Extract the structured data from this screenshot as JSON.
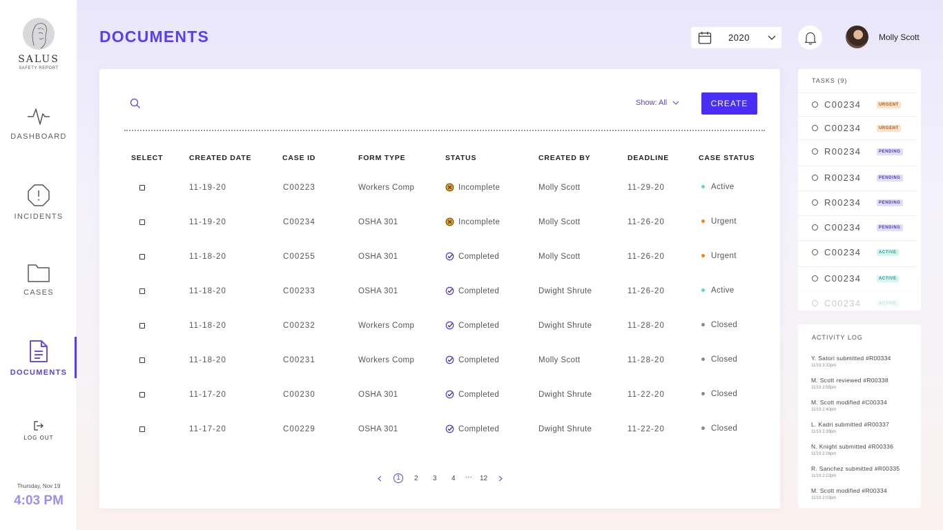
{
  "brand": {
    "name": "SALUS",
    "tagline": "SAFETY REPORT"
  },
  "nav": {
    "dashboard": "DASHBOARD",
    "incidents": "INCIDENTS",
    "cases": "CASES",
    "documents": "DOCUMENTS",
    "logout": "LOG OUT"
  },
  "clock": {
    "date": "Thursday, Nov 19",
    "time": "4:03 PM"
  },
  "header": {
    "title": "DOCUMENTS",
    "year": "2020",
    "user": "Molly Scott"
  },
  "toolbar": {
    "show_filter": "Show: All",
    "create_label": "CREATE"
  },
  "table": {
    "headers": [
      "SELECT",
      "CREATED DATE",
      "CASE ID",
      "FORM TYPE",
      "STATUS",
      "CREATED BY",
      "DEADLINE",
      "CASE STATUS"
    ],
    "rows": [
      {
        "created": "11-19-20",
        "case_id": "C00223",
        "form": "Workers Comp",
        "status": "Incomplete",
        "by": "Molly Scott",
        "deadline": "11-29-20",
        "case_status": "Active"
      },
      {
        "created": "11-19-20",
        "case_id": "C00234",
        "form": "OSHA 301",
        "status": "Incomplete",
        "by": "Molly Scott",
        "deadline": "11-26-20",
        "case_status": "Urgent"
      },
      {
        "created": "11-18-20",
        "case_id": "C00255",
        "form": "OSHA 301",
        "status": "Completed",
        "by": "Molly Scott",
        "deadline": "11-26-20",
        "case_status": "Urgent"
      },
      {
        "created": "11-18-20",
        "case_id": "C00233",
        "form": "OSHA 301",
        "status": "Completed",
        "by": "Dwight Shrute",
        "deadline": "11-26-20",
        "case_status": "Active"
      },
      {
        "created": "11-18-20",
        "case_id": "C00232",
        "form": "Workers Comp",
        "status": "Completed",
        "by": "Dwight Shrute",
        "deadline": "11-28-20",
        "case_status": "Closed"
      },
      {
        "created": "11-18-20",
        "case_id": "C00231",
        "form": "Workers Comp",
        "status": "Completed",
        "by": "Molly Scott",
        "deadline": "11-28-20",
        "case_status": "Closed"
      },
      {
        "created": "11-17-20",
        "case_id": "C00230",
        "form": "OSHA 301",
        "status": "Completed",
        "by": "Dwight Shrute",
        "deadline": "11-22-20",
        "case_status": "Closed"
      },
      {
        "created": "11-17-20",
        "case_id": "C00229",
        "form": "OSHA 301",
        "status": "Completed",
        "by": "Dwight Shrute",
        "deadline": "11-22-20",
        "case_status": "Closed"
      }
    ]
  },
  "pagination": {
    "pages": [
      "1",
      "2",
      "3",
      "4",
      "···",
      "12"
    ],
    "current": "1"
  },
  "tasks": {
    "title": "TASKS (9)",
    "items": [
      {
        "id": "C00234",
        "badge": "URGENT",
        "kind": "urgent"
      },
      {
        "id": "C00234",
        "badge": "URGENT",
        "kind": "urgent"
      },
      {
        "id": "R00234",
        "badge": "PENDING",
        "kind": "pending"
      },
      {
        "id": "R00234",
        "badge": "PENDING",
        "kind": "pending"
      },
      {
        "id": "R00234",
        "badge": "PENDING",
        "kind": "pending"
      },
      {
        "id": "C00234",
        "badge": "PENDING",
        "kind": "pending"
      },
      {
        "id": "C00234",
        "badge": "ACTIVE",
        "kind": "active"
      },
      {
        "id": "C00234",
        "badge": "ACTIVE",
        "kind": "active"
      },
      {
        "id": "C00234",
        "badge": "ACTIVE",
        "kind": "active"
      }
    ]
  },
  "activity": {
    "title": "ACTIVITY LOG",
    "items": [
      {
        "text": "Y. Satori submitted #R00334",
        "time": "11/19 3:32pm"
      },
      {
        "text": "M. Scott reviewed #R00338",
        "time": "11/19 2:55pm"
      },
      {
        "text": "M. Scott modified  #C00334",
        "time": "11/19 2:40pm"
      },
      {
        "text": "L. Kadri submitted #R00337",
        "time": "11/19 2:39pm"
      },
      {
        "text": "N. Knight submitted #R00336",
        "time": "11/19 2:26pm"
      },
      {
        "text": "R. Sanchez submitted #R00335",
        "time": "11/19 2:22pm"
      },
      {
        "text": "M. Scott modified #R00334",
        "time": "11/19 2:03pm"
      }
    ]
  },
  "colors": {
    "accent": "#5b3df5",
    "active_dot": "#5fd3c4",
    "urgent_dot": "#f08a00",
    "closed_dot": "#8a8a8a",
    "incomplete_icon": "#f0a500",
    "completed_icon": "#5b3df5"
  },
  "icons": {
    "search": "search-icon",
    "calendar": "calendar-icon",
    "bell": "bell-icon",
    "dashboard": "pulse-icon",
    "incidents": "alert-octagon-icon",
    "cases": "folder-icon",
    "documents": "document-icon",
    "logout": "logout-icon"
  }
}
